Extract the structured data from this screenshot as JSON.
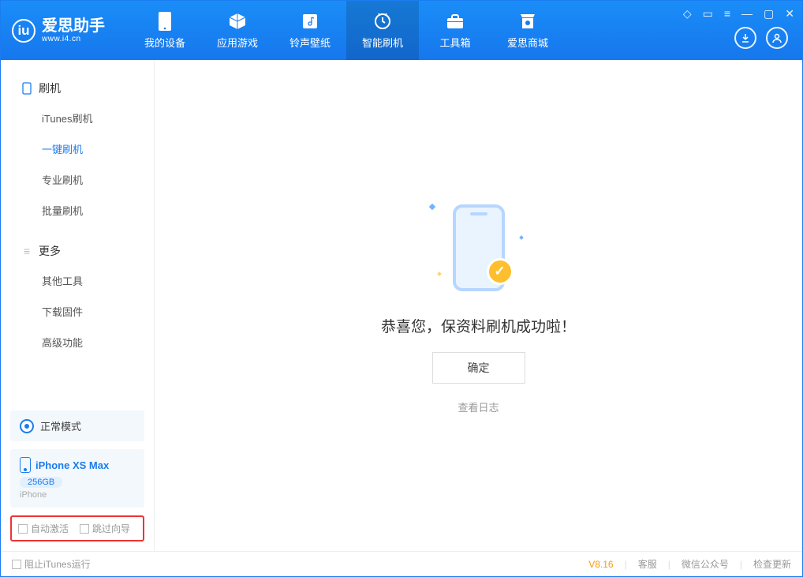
{
  "app": {
    "title": "爱思助手",
    "subtitle": "www.i4.cn"
  },
  "nav": {
    "items": [
      {
        "label": "我的设备"
      },
      {
        "label": "应用游戏"
      },
      {
        "label": "铃声壁纸"
      },
      {
        "label": "智能刷机"
      },
      {
        "label": "工具箱"
      },
      {
        "label": "爱思商城"
      }
    ]
  },
  "sidebar": {
    "sections": {
      "flash": {
        "title": "刷机",
        "items": [
          {
            "label": "iTunes刷机"
          },
          {
            "label": "一键刷机"
          },
          {
            "label": "专业刷机"
          },
          {
            "label": "批量刷机"
          }
        ]
      },
      "more": {
        "title": "更多",
        "items": [
          {
            "label": "其他工具"
          },
          {
            "label": "下载固件"
          },
          {
            "label": "高级功能"
          }
        ]
      }
    },
    "mode": {
      "label": "正常模式"
    },
    "device": {
      "name": "iPhone XS Max",
      "storage": "256GB",
      "type": "iPhone"
    },
    "options": {
      "autoActivate": "自动激活",
      "skipGuide": "跳过向导"
    }
  },
  "main": {
    "successText": "恭喜您，保资料刷机成功啦！",
    "okLabel": "确定",
    "logLabel": "查看日志"
  },
  "footer": {
    "blockItunes": "阻止iTunes运行",
    "version": "V8.16",
    "support": "客服",
    "wechat": "微信公众号",
    "update": "检查更新"
  }
}
